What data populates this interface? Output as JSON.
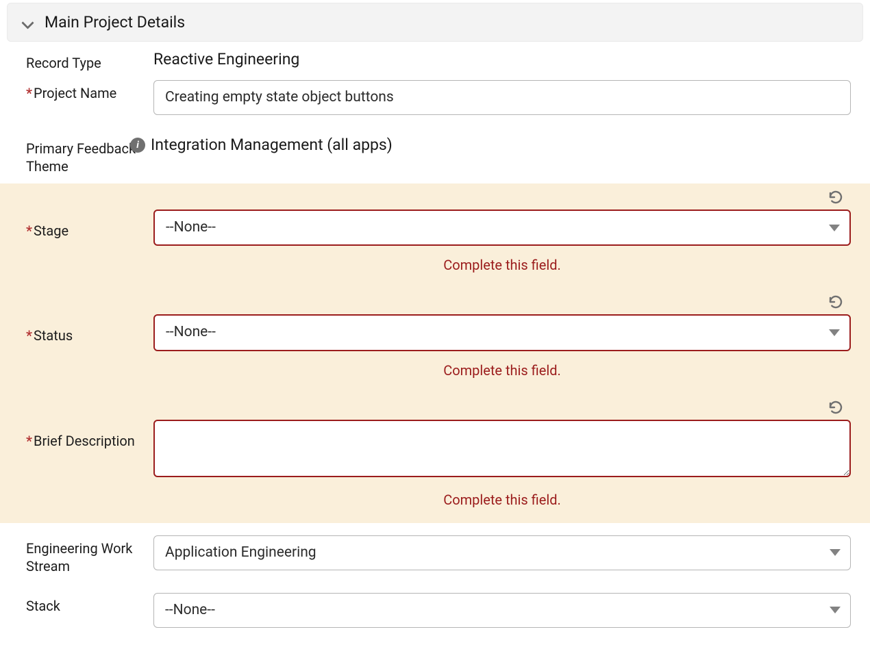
{
  "section": {
    "title": "Main Project Details"
  },
  "fields": {
    "record_type": {
      "label": "Record Type",
      "value": "Reactive Engineering"
    },
    "project_name": {
      "label": "Project Name",
      "value": "Creating empty state object buttons"
    },
    "primary_feedback_theme": {
      "label": "Primary Feedback Theme",
      "value": "Integration Management (all apps)"
    },
    "stage": {
      "label": "Stage",
      "value": "--None--",
      "error": "Complete this field."
    },
    "status": {
      "label": "Status",
      "value": "--None--",
      "error": "Complete this field."
    },
    "brief_description": {
      "label": "Brief Description",
      "value": "",
      "error": "Complete this field."
    },
    "engineering_work_stream": {
      "label": "Engineering Work Stream",
      "value": "Application Engineering"
    },
    "stack": {
      "label": "Stack",
      "value": "--None--"
    }
  }
}
